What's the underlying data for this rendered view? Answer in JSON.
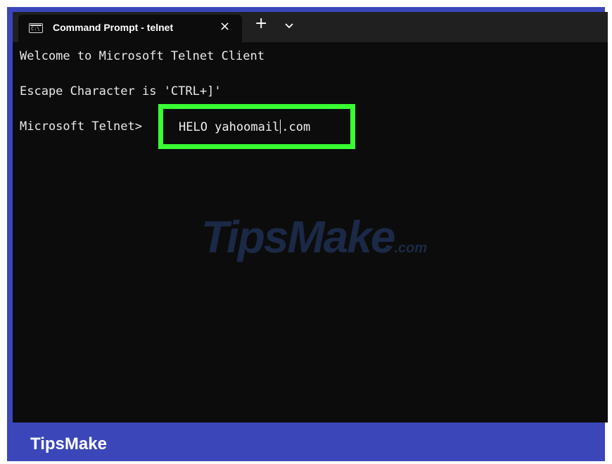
{
  "window": {
    "tab_title": "Command Prompt - telnet",
    "tab_icon_text": "C:\\",
    "close_symbol": "×",
    "new_tab_symbol": "+",
    "dropdown_icon": "chevron-down-icon"
  },
  "terminal": {
    "lines": [
      "Welcome to Microsoft Telnet Client",
      "Escape Character is 'CTRL+]'",
      "Microsoft Telnet>"
    ],
    "input_before_cursor": "HELO yahoomail",
    "input_after_cursor": ".com"
  },
  "watermark": {
    "text": "TipsMake",
    "suffix": ".com"
  },
  "footer": {
    "brand": "TipsMake"
  },
  "colors": {
    "frame": "#3b47b8",
    "terminal_bg": "#0c0c0c",
    "highlight": "#39ff35",
    "text": "#e8e8e8"
  }
}
